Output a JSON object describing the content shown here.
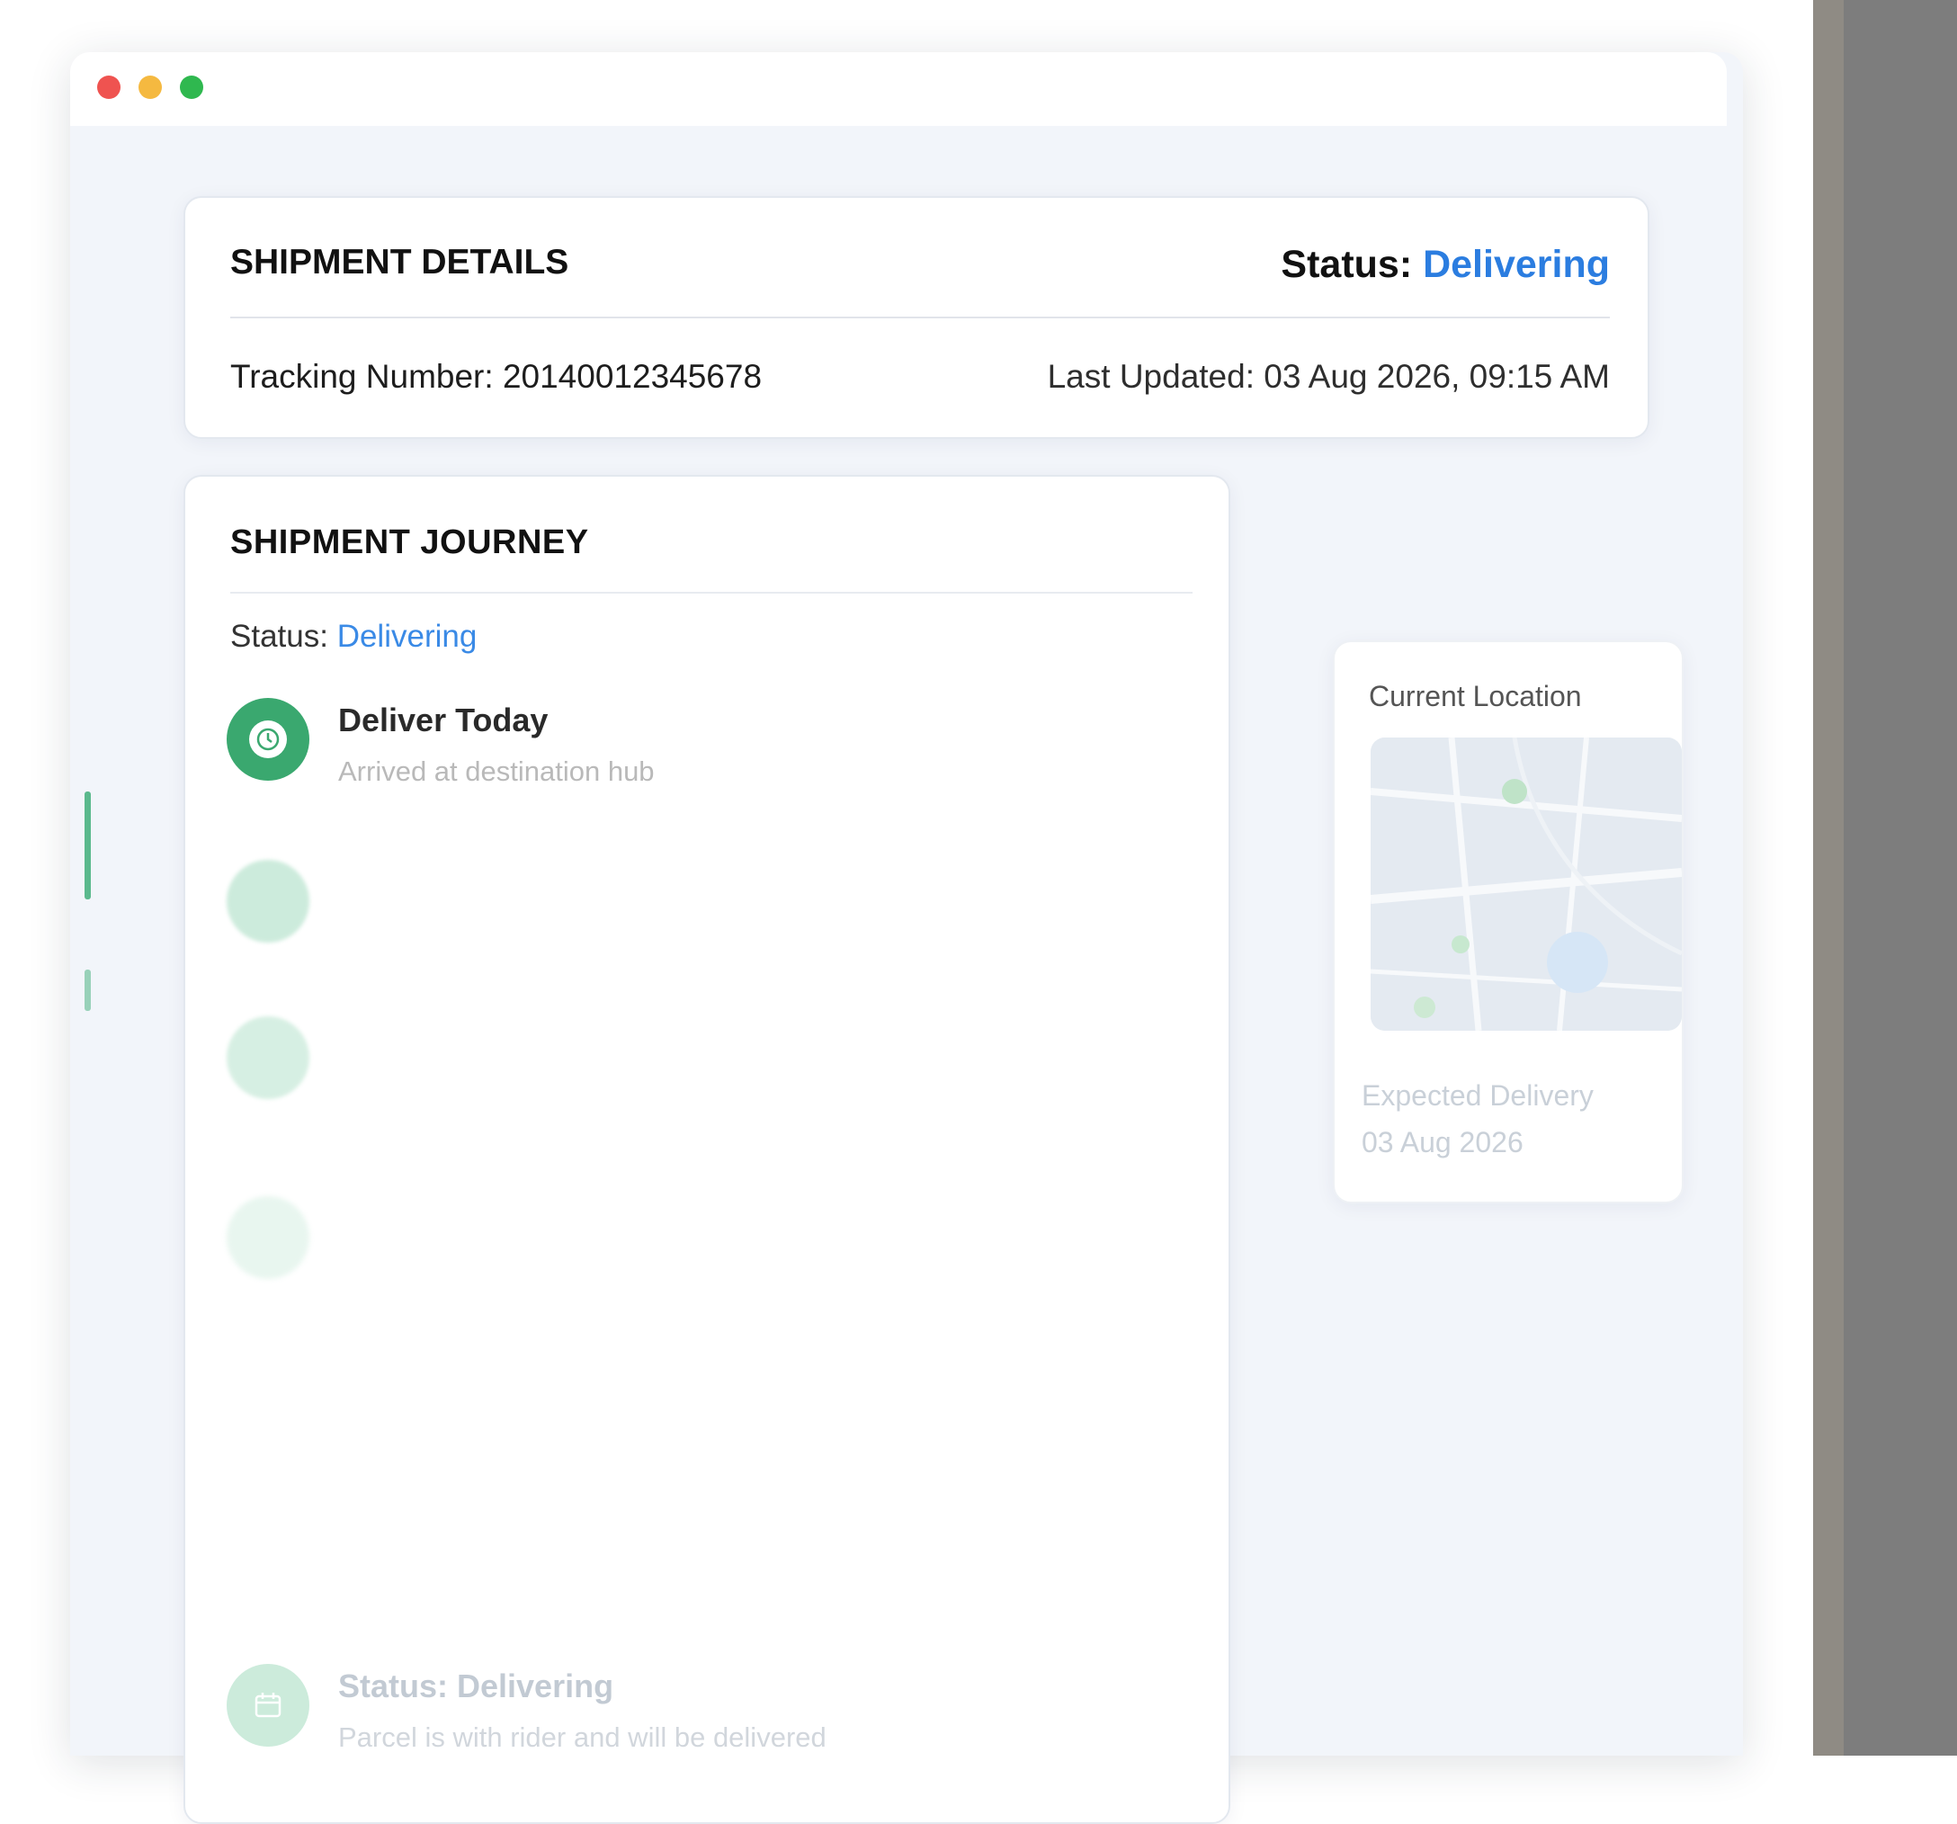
{
  "window": {
    "controls": [
      "close",
      "minimize",
      "zoom"
    ]
  },
  "shipment_details": {
    "title": "SHIPMENT DETAILS",
    "status_label": "Status:",
    "status_value": "Delivering",
    "tracking_label": "Tracking Number:",
    "tracking_number": "20140012345678",
    "updated_label": "Last Updated:",
    "updated_value": "03 Aug 2026, 09:15 AM"
  },
  "journey": {
    "title": "SHIPMENT JOURNEY",
    "status_label": "Status:",
    "status_value": "Delivering",
    "events": [
      {
        "title": "Deliver Today",
        "desc": "Arrived at destination hub",
        "time": "",
        "icon": "clock-icon"
      },
      {
        "title": "",
        "desc": "",
        "time": "",
        "icon": "box-icon"
      },
      {
        "title": "",
        "desc": "",
        "time": "",
        "icon": "location-icon"
      },
      {
        "title": "",
        "desc": "",
        "time": "",
        "icon": "truck-icon"
      },
      {
        "title": "Status: Delivering",
        "desc": "Parcel is with rider and will be delivered",
        "time": "",
        "icon": "calendar-icon"
      }
    ]
  },
  "location": {
    "title": "Current Location",
    "expected_label": "Expected Delivery",
    "expected_date": "03 Aug 2026"
  },
  "colors": {
    "accent": "#2b7de0",
    "timeline_green": "#3aa86f",
    "background": "#f2f5fa"
  }
}
